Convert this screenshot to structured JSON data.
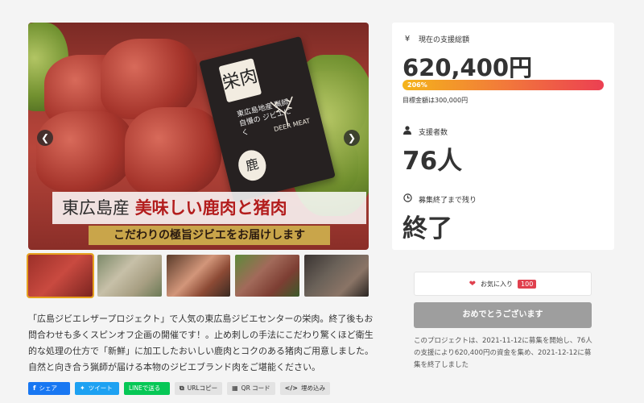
{
  "hero": {
    "package_label": "栄肉",
    "package_text": "東広島地産 猟師自慢の ジビエにく",
    "package_circle": "鹿",
    "package_deer_text": "DEER MEAT",
    "title_prefix": "東広島産",
    "title_highlight": "美味しい鹿肉と猪肉",
    "subtitle": "こだわりの極旨ジビエをお届けします",
    "prev_icon": "chevron-left-icon",
    "next_icon": "chevron-right-icon"
  },
  "thumbnails": [
    {
      "name": "thumbnail-1",
      "active": true
    },
    {
      "name": "thumbnail-2",
      "active": false
    },
    {
      "name": "thumbnail-3",
      "active": false
    },
    {
      "name": "thumbnail-4",
      "active": false
    },
    {
      "name": "thumbnail-5",
      "active": false
    }
  ],
  "description": "「広島ジビエレザープロジェクト」で人気の東広島ジビエセンターの栄肉。終了後もお問合わせも多くスピンオフ企画の開催です！。止め刺しの手法にこだわり驚くほど衛生的な処理の仕方で「新鮮」に加工したおいしい鹿肉とコクのある猪肉ご用意しました。自然と向き合う猟師が届ける本物のジビエブランド肉をご堪能ください。",
  "share": {
    "facebook": "シェア",
    "twitter": "ツイート",
    "line": "LINEで送る",
    "url_copy": "URLコピー",
    "qr_code": "QR コード",
    "embed": "埋め込み"
  },
  "stats": {
    "total_label": "現在の支援総額",
    "total_value": "620,400円",
    "progress_pct": "206%",
    "progress_fraction": 2.06,
    "goal_text": "目標金額は300,000円",
    "supporters_label": "支援者数",
    "supporters_value": "76人",
    "remaining_label": "募集終了まで残り",
    "remaining_value": "終了"
  },
  "favorite": {
    "label": "お気に入り",
    "count": "100"
  },
  "done_button": "おめでとうございます",
  "closing_note": "このプロジェクトは、2021-11-12に募集を開始し、76人の支援により620,400円の資金を集め、2021-12-12に募集を終了しました",
  "colors": {
    "progress_start": "#f4b41a",
    "progress_end": "#ec3f52",
    "heart": "#e0404e",
    "done_button": "#9e9e9e"
  }
}
